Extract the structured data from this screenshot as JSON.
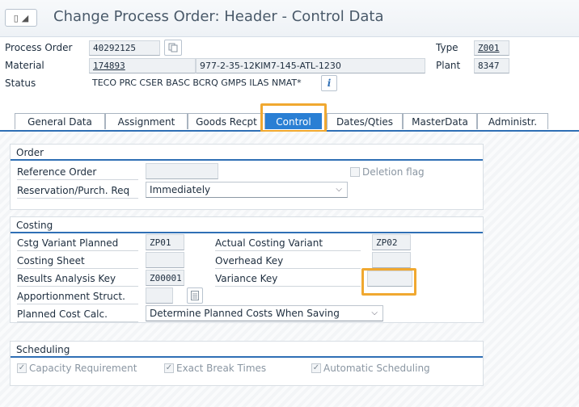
{
  "header": {
    "title": "Change Process Order: Header - Control Data",
    "process_order_label": "Process Order",
    "process_order_value": "40292125",
    "material_label": "Material",
    "material_value": "174893",
    "material_desc": "977-2-35-12KIM7-145-ATL-1230",
    "status_label": "Status",
    "status_value": "TECO PRC  CSER BASC BCRQ GMPS ILAS NMAT*",
    "type_label": "Type",
    "type_value": "Z001",
    "plant_label": "Plant",
    "plant_value": "8347"
  },
  "tabs": [
    {
      "label": "General Data"
    },
    {
      "label": "Assignment"
    },
    {
      "label": "Goods Recpt"
    },
    {
      "label": "Control"
    },
    {
      "label": "Dates/Qties"
    },
    {
      "label": "MasterData"
    },
    {
      "label": "Administr."
    }
  ],
  "order_group": {
    "title": "Order",
    "reference_order_label": "Reference Order",
    "reference_order_value": "",
    "deletion_flag_label": "Deletion flag",
    "reservation_label": "Reservation/Purch. Req",
    "reservation_value": "Immediately"
  },
  "costing_group": {
    "title": "Costing",
    "cstg_variant_planned_label": "Cstg Variant Planned",
    "cstg_variant_planned_value": "ZP01",
    "actual_costing_variant_label": "Actual Costing Variant",
    "actual_costing_variant_value": "ZP02",
    "costing_sheet_label": "Costing Sheet",
    "costing_sheet_value": "",
    "overhead_key_label": "Overhead Key",
    "overhead_key_value": "",
    "results_analysis_key_label": "Results Analysis Key",
    "results_analysis_key_value": "Z00001",
    "variance_key_label": "Variance Key",
    "variance_key_value": "",
    "apportionment_label": "Apportionment Struct.",
    "apportionment_value": "",
    "planned_cost_calc_label": "Planned Cost Calc.",
    "planned_cost_calc_value": "Determine Planned Costs When Saving"
  },
  "scheduling_group": {
    "title": "Scheduling",
    "capacity_requirement_label": "Capacity Requirement",
    "exact_break_times_label": "Exact Break Times",
    "automatic_scheduling_label": "Automatic Scheduling"
  },
  "colors": {
    "active_tab": "#2a7fd4",
    "section_rule": "#2f6fb5",
    "highlight": "#f0a830"
  }
}
